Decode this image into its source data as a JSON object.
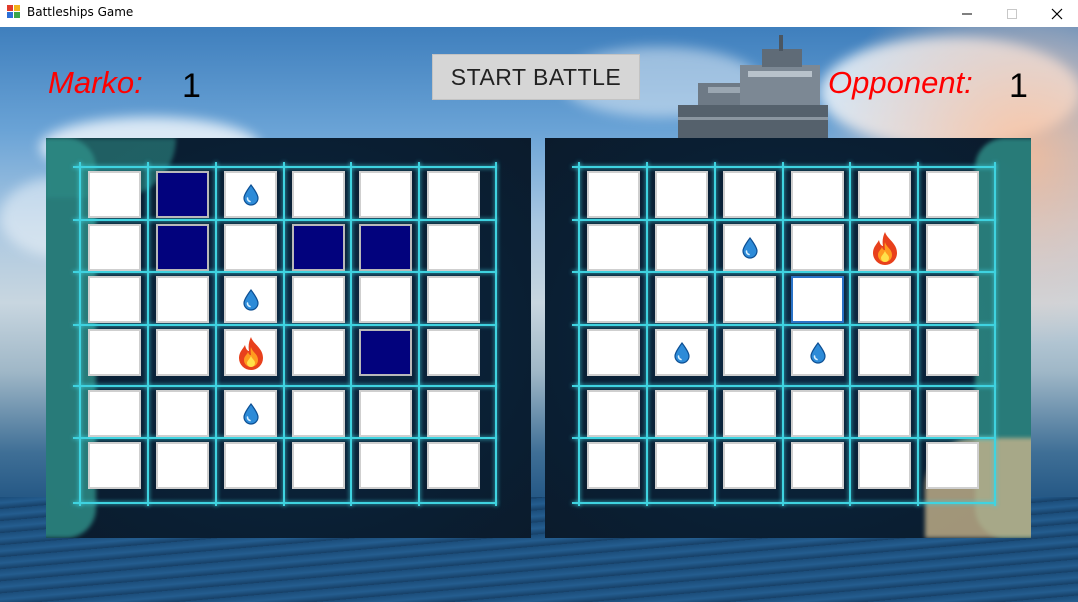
{
  "window": {
    "title": "Battleships Game"
  },
  "scores": {
    "player_name": "Marko:",
    "player_score": "1",
    "opponent_name": "Opponent:",
    "opponent_score": "1"
  },
  "start_button": {
    "label": "START BATTLE"
  },
  "player_board": {
    "rows": [
      [
        "empty",
        "ship",
        "water",
        "empty",
        "empty",
        "empty"
      ],
      [
        "empty",
        "ship",
        "empty",
        "ship",
        "ship",
        "empty"
      ],
      [
        "empty",
        "empty",
        "water",
        "empty",
        "empty",
        "empty"
      ],
      [
        "empty",
        "empty",
        "fire",
        "empty",
        "ship",
        "empty"
      ],
      [
        "empty",
        "empty",
        "water",
        "empty",
        "empty",
        "empty"
      ],
      [
        "empty",
        "empty",
        "empty",
        "empty",
        "empty",
        "empty"
      ]
    ]
  },
  "opponent_board": {
    "rows": [
      [
        "empty",
        "empty",
        "empty",
        "empty",
        "empty",
        "empty"
      ],
      [
        "empty",
        "empty",
        "water",
        "empty",
        "fire",
        "empty"
      ],
      [
        "empty",
        "empty",
        "empty",
        "focus",
        "empty",
        "empty"
      ],
      [
        "empty",
        "water",
        "empty",
        "water",
        "empty",
        "empty"
      ],
      [
        "empty",
        "empty",
        "empty",
        "empty",
        "empty",
        "empty"
      ],
      [
        "empty",
        "empty",
        "empty",
        "empty",
        "empty",
        "empty"
      ]
    ]
  },
  "icons": {
    "water": "water-drop-icon",
    "fire": "fire-icon"
  },
  "colors": {
    "ship": "#02027d",
    "score_name": "#ff0000",
    "grid": "#3fd3e0"
  }
}
